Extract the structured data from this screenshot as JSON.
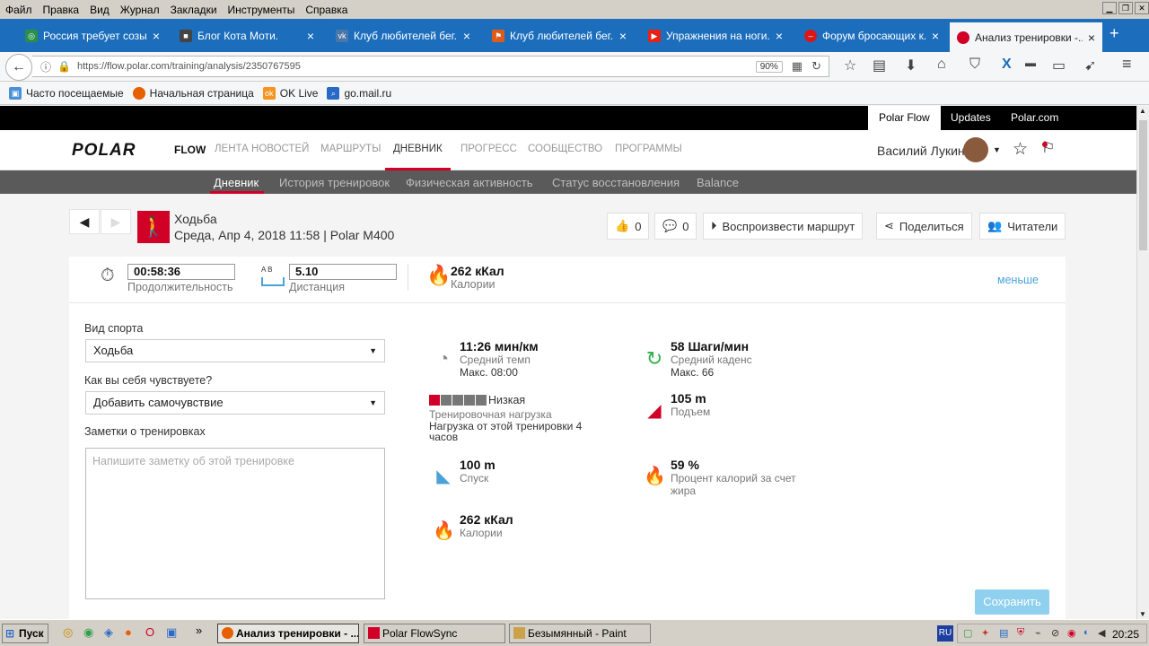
{
  "menu": [
    "Файл",
    "Правка",
    "Вид",
    "Журнал",
    "Закладки",
    "Инструменты",
    "Справка"
  ],
  "tabs": [
    {
      "title": "Россия требует созы...",
      "icon": "speech-globe-icon",
      "color": "#2a8f4a"
    },
    {
      "title": "Блог Кота Моти.",
      "icon": "cat-icon",
      "color": "#444444"
    },
    {
      "title": "Клуб любителей бег...",
      "icon": "vk-icon",
      "color": "#4a76a8"
    },
    {
      "title": "Клуб любителей бег...",
      "icon": "runner-icon",
      "color": "#e05a1a"
    },
    {
      "title": "Упражнения на ноги...",
      "icon": "youtube-icon",
      "color": "#e62117"
    },
    {
      "title": "Форум бросающих к...",
      "icon": "no-entry-icon",
      "color": "#d81818"
    },
    {
      "title": "Анализ тренировки -...",
      "icon": "polar-icon",
      "color": "#d10027"
    }
  ],
  "address": {
    "url": "https://flow.polar.com/training/analysis/2350767595",
    "zoom": "90%"
  },
  "bookmarks": [
    "Часто посещаемые",
    "Начальная страница",
    "OK Live",
    "go.mail.ru"
  ],
  "polar_top": [
    "Polar Flow",
    "Updates",
    "Polar.com"
  ],
  "brand": {
    "logo": "POLAR",
    "product": "FLOW"
  },
  "mainnav": [
    "ЛЕНТА НОВОСТЕЙ",
    "МАРШРУТЫ",
    "ДНЕВНИК",
    "ПРОГРЕСС",
    "СООБЩЕСТВО",
    "ПРОГРАММЫ"
  ],
  "user": {
    "name": "Василий Лукин"
  },
  "subnav": [
    "Дневник",
    "История тренировок",
    "Физическая активность",
    "Статус восстановления",
    "Balance"
  ],
  "workout": {
    "sport": "Ходьба",
    "subtitle": "Среда, Апр 4, 2018 11:58 | Polar M400"
  },
  "actions": {
    "likes": "0",
    "comments": "0",
    "replay": "Воспроизвести маршрут",
    "share": "Поделиться",
    "followers": "Читатели"
  },
  "summary": {
    "duration": "00:58:36",
    "duration_label": "Продолжительность",
    "distance": "5.10",
    "distance_label": "Дистанция",
    "ab": "A  B",
    "calories": "262 кКал",
    "calories_label": "Калории",
    "less": "меньше"
  },
  "form": {
    "sport_label": "Вид спорта",
    "sport_value": "Ходьба",
    "feeling_label": "Как вы себя чувствуете?",
    "feeling_value": "Добавить самочувствие",
    "notes_label": "Заметки о тренировках",
    "notes_placeholder": "Напишите заметку об этой тренировке"
  },
  "metrics": {
    "pace": {
      "value": "11:26 мин/км",
      "label": "Средний темп",
      "max": "Макс. 08:00"
    },
    "cadence": {
      "value": "58 Шаги/мин",
      "label": "Средний каденс",
      "max": "Макс. 66"
    },
    "load": {
      "level": "Низкая",
      "label": "Тренировочная нагрузка",
      "detail": "Нагрузка от этой тренировки 4 часов",
      "filled": 1,
      "total": 5
    },
    "ascent": {
      "value": "105 m",
      "label": "Подъем"
    },
    "descent": {
      "value": "100 m",
      "label": "Спуск"
    },
    "fat": {
      "value": "59 %",
      "label": "Процент калорий за счет жира"
    },
    "calories": {
      "value": "262 кКал",
      "label": "Калории"
    }
  },
  "save": "Сохранить",
  "taskbar": {
    "start": "Пуск",
    "tasks": [
      "Анализ тренировки - ...",
      "Polar FlowSync",
      "Безымянный - Paint"
    ],
    "lang": "RU",
    "time": "20:25"
  }
}
